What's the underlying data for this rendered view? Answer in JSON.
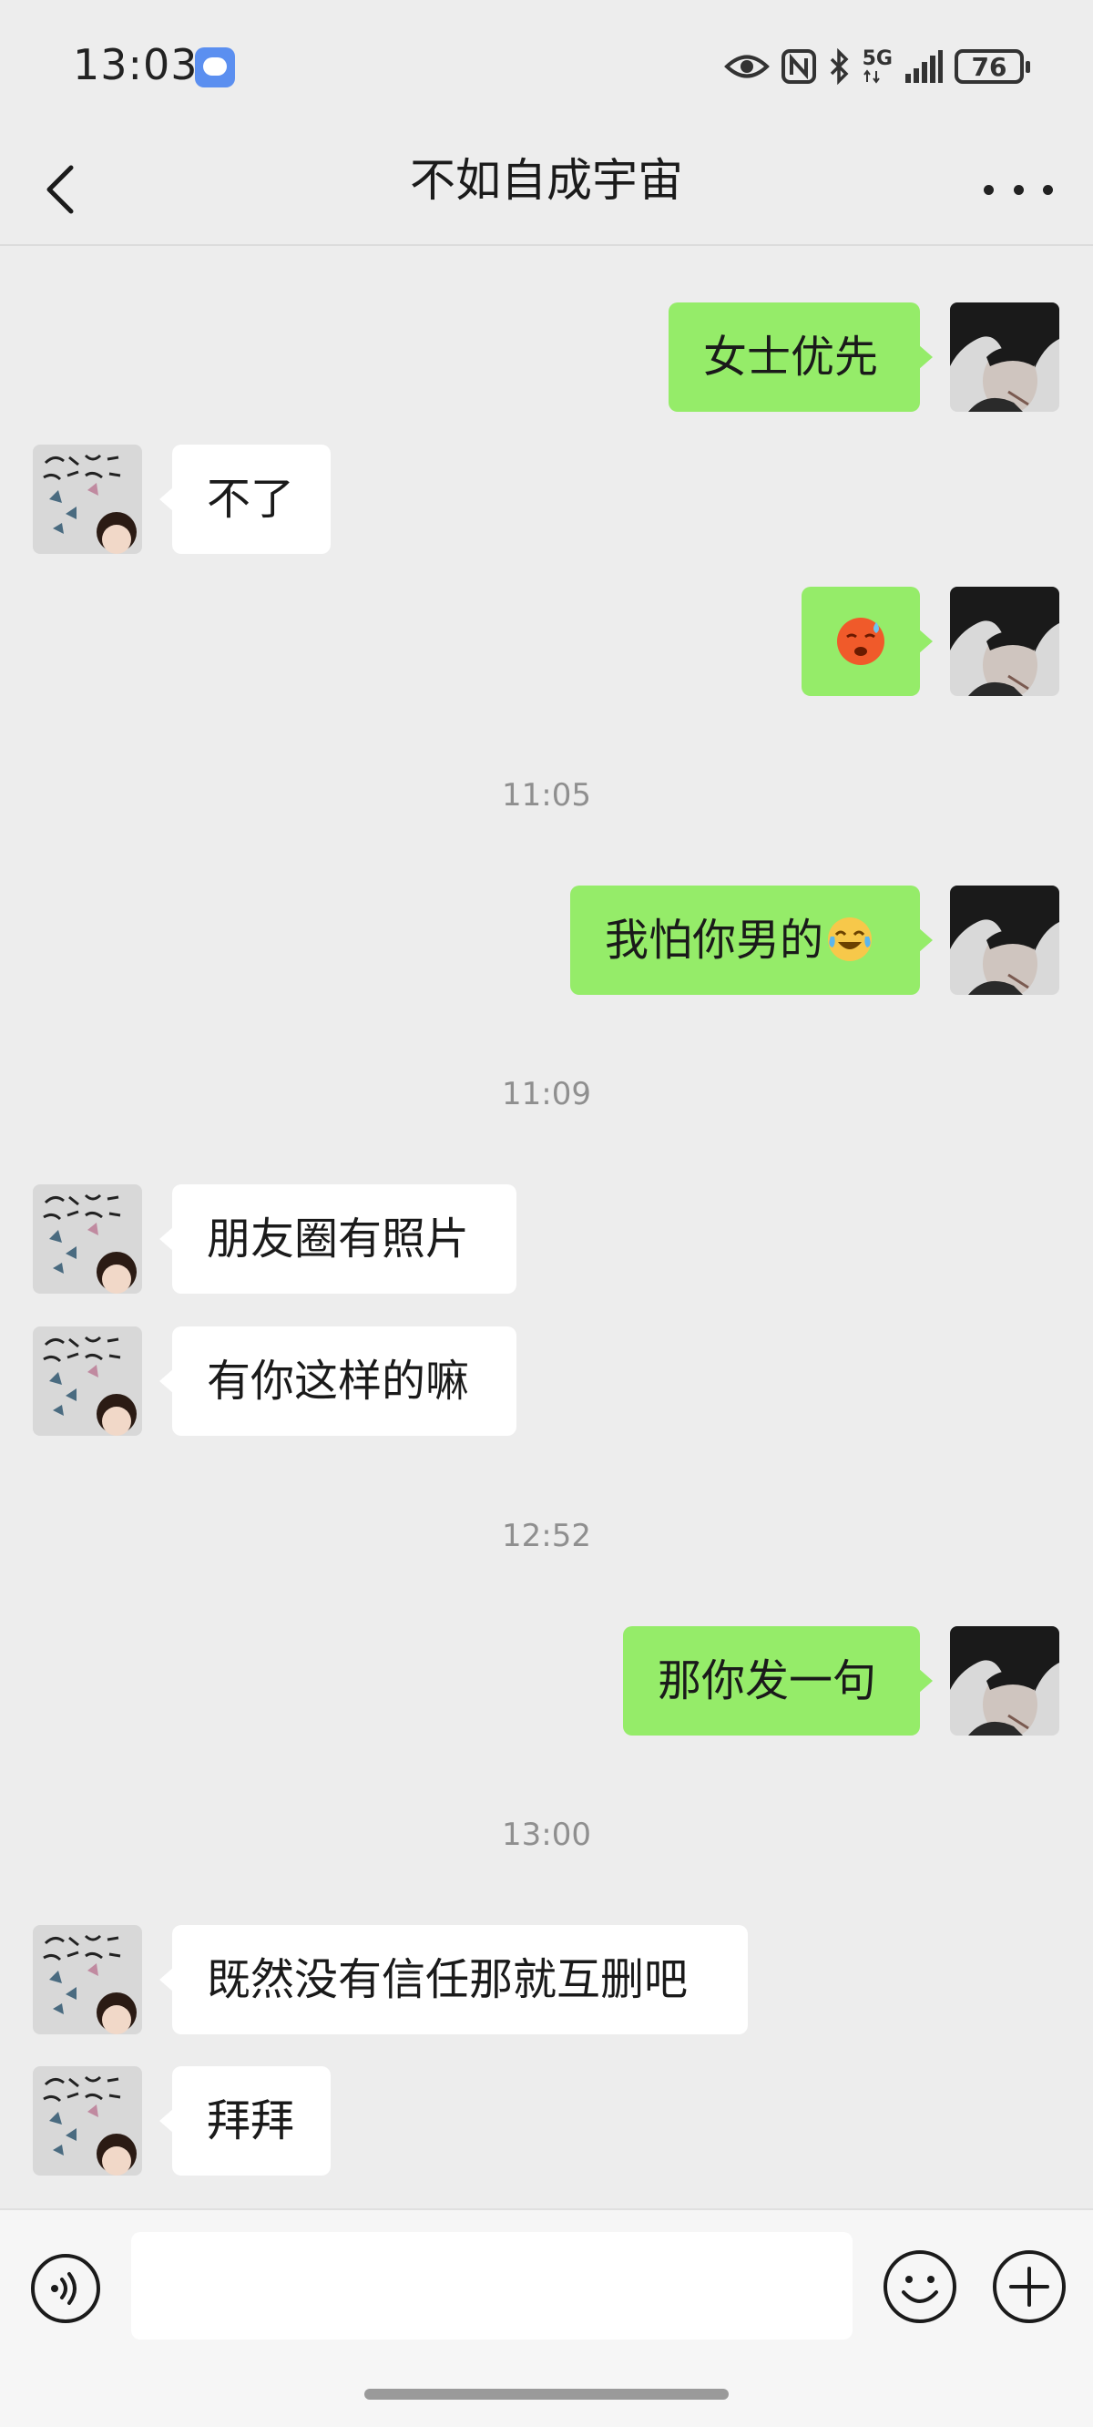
{
  "status_bar": {
    "time": "13:03",
    "network_label": "5G",
    "battery": "76"
  },
  "header": {
    "title": "不如自成宇宙"
  },
  "messages": [
    {
      "side": "me",
      "text": "女士优先"
    },
    {
      "side": "them",
      "text": "不了"
    },
    {
      "side": "me",
      "text": "",
      "emoji": "hot-face-sweat-emoji"
    },
    {
      "side": "timestamp",
      "text": "11:05"
    },
    {
      "side": "me",
      "text": "我怕你男的",
      "emoji": "laughing-tears-emoji"
    },
    {
      "side": "timestamp",
      "text": "11:09"
    },
    {
      "side": "them",
      "text": "朋友圈有照片"
    },
    {
      "side": "them",
      "text": "有你这样的嘛"
    },
    {
      "side": "timestamp",
      "text": "12:52"
    },
    {
      "side": "me",
      "text": "那你发一句"
    },
    {
      "side": "timestamp",
      "text": "13:00"
    },
    {
      "side": "them",
      "text": "既然没有信任那就互删吧"
    },
    {
      "side": "them",
      "text": "拜拜"
    }
  ],
  "input_bar": {
    "placeholder": ""
  },
  "colors": {
    "background": "#ededed",
    "my_bubble": "#95ec69",
    "their_bubble": "#ffffff",
    "timestamp": "#8f8f8f"
  }
}
